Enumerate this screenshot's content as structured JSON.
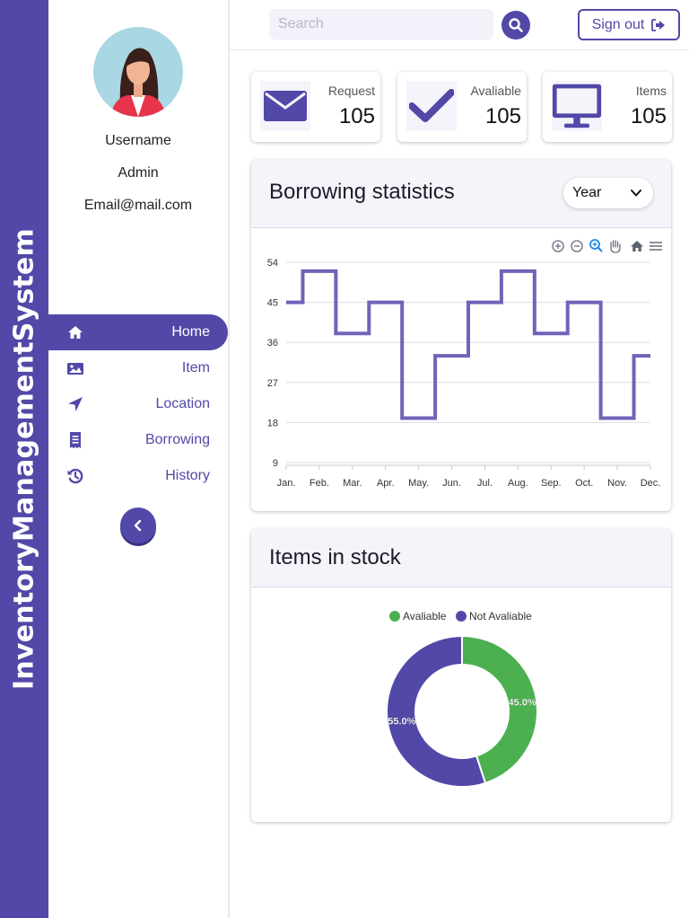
{
  "brand": {
    "title": "InventoryManagementSystem"
  },
  "profile": {
    "username": "Username",
    "role": "Admin",
    "email": "Email@mail.com"
  },
  "sidebar": {
    "items": [
      {
        "label": "Home",
        "icon": "home-icon",
        "active": true
      },
      {
        "label": "Item",
        "icon": "image-icon",
        "active": false
      },
      {
        "label": "Location",
        "icon": "location-arrow-icon",
        "active": false
      },
      {
        "label": "Borrowing",
        "icon": "receipt-icon",
        "active": false
      },
      {
        "label": "History",
        "icon": "history-icon",
        "active": false
      }
    ]
  },
  "header": {
    "search_placeholder": "Search",
    "search_value": "",
    "signout_label": "Sign out"
  },
  "stats": [
    {
      "label": "Request",
      "value": "105",
      "icon": "envelope-icon"
    },
    {
      "label": "Avaliable",
      "value": "105",
      "icon": "check-icon"
    },
    {
      "label": "Items",
      "value": "105",
      "icon": "monitor-icon"
    }
  ],
  "colors": {
    "brand": "#5248a8",
    "available": "#4caf50",
    "not_available": "#5248a8",
    "line": "#6e64b8"
  },
  "borrowing": {
    "title": "Borrowing statistics",
    "period": "Year",
    "toolbar": [
      "zoom-in-icon",
      "zoom-out-icon",
      "zoom-select-icon",
      "pan-icon",
      "reset-home-icon",
      "menu-icon"
    ]
  },
  "stock": {
    "title": "Items in stock"
  },
  "chart_data": [
    {
      "type": "line",
      "step": true,
      "categories": [
        "Jan.",
        "Feb.",
        "Mar.",
        "Apr.",
        "May.",
        "Jun.",
        "Jul.",
        "Aug.",
        "Sep.",
        "Oct.",
        "Nov.",
        "Dec."
      ],
      "values": [
        45,
        52,
        38,
        45,
        19,
        33,
        45,
        52,
        38,
        45,
        19,
        33
      ],
      "ylim": [
        9,
        54
      ],
      "yticks": [
        "54",
        "45",
        "36",
        "27",
        "18",
        "9"
      ],
      "grid": true
    },
    {
      "type": "pie",
      "donut": true,
      "labels": [
        "Avaliable",
        "Not Avaliable"
      ],
      "values": [
        45.0,
        55.0
      ],
      "slice_labels": [
        "45.0%",
        "55.0%"
      ],
      "legend": "top-center"
    }
  ]
}
